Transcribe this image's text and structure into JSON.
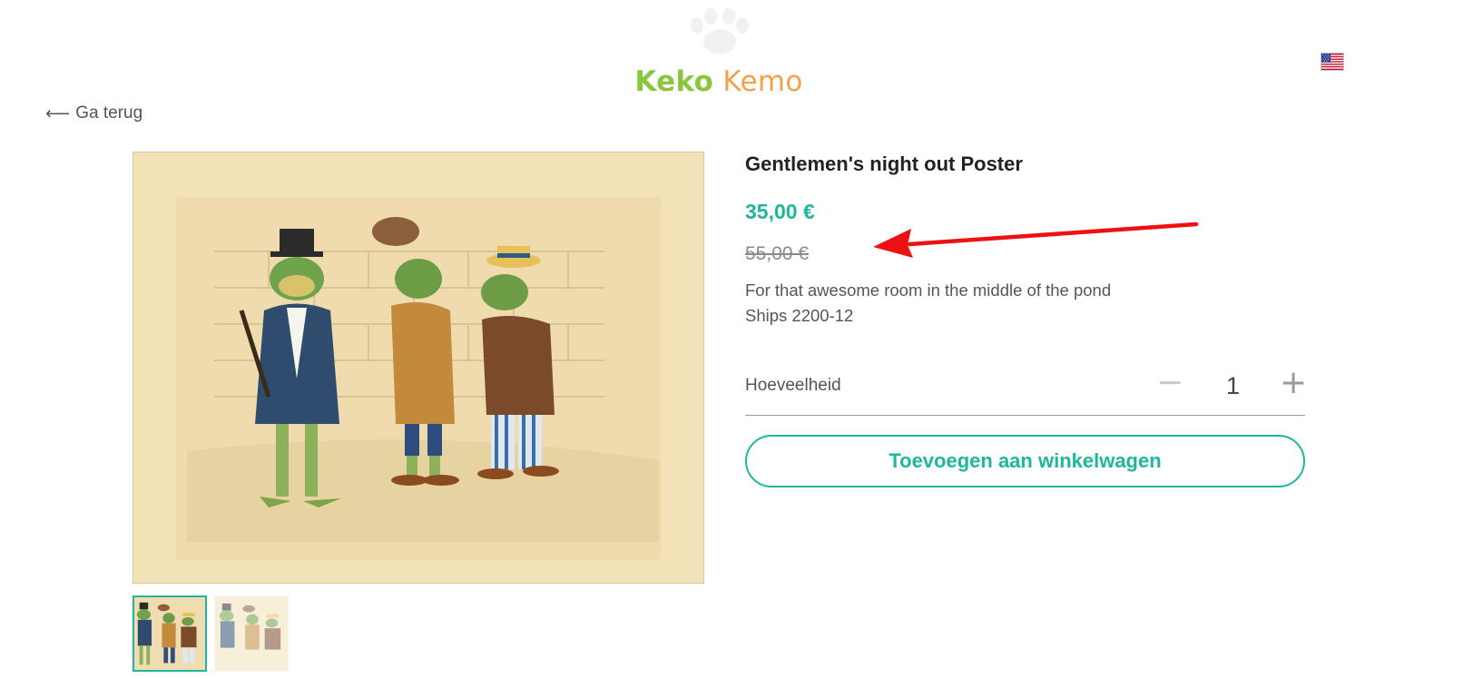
{
  "header": {
    "brand_first": "Keko",
    "brand_second": "Kemo",
    "language_flag_icon": "us-flag-icon"
  },
  "nav": {
    "back_label": "Ga terug"
  },
  "product": {
    "title": "Gentlemen's night out Poster",
    "price": "35,00 €",
    "old_price": "55,00 €",
    "description_line1": "For that awesome room in the middle of the pond",
    "description_line2": "Ships 2200-12",
    "quantity_label": "Hoeveelheid",
    "quantity_value": "1",
    "minus_symbol": "−",
    "plus_symbol": "+",
    "add_to_cart_label": "Toevoegen aan winkelwagen",
    "selected_thumbnail_index": 0
  },
  "colors": {
    "accent_teal": "#1fb79b",
    "brand_green": "#8cc63f",
    "brand_orange": "#f5a04a",
    "annotation_red": "#ee1111"
  }
}
